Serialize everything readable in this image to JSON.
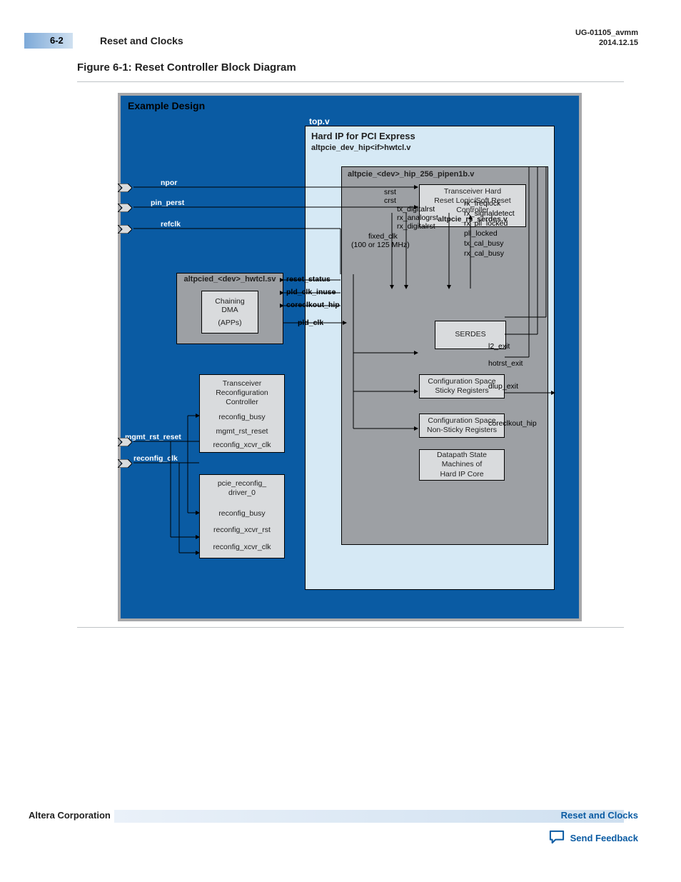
{
  "header": {
    "page_num": "6-2",
    "title": "Reset and Clocks",
    "doc_id": "UG-01105_avmm",
    "doc_date": "2014.12.15"
  },
  "figure": {
    "title": "Figure 6-1: Reset Controller Block Diagram",
    "example_design": "Example Design",
    "topv": "top.v",
    "hip_title": "Hard IP for PCI Express",
    "hip_sub": "altpcie_dev_hip<if>hwtcl.v",
    "pipen_title": "altpcie_<dev>_hip_256_pipen1b.v",
    "apps_title": "altpcied_<dev>_hwtcl.sv",
    "apps_line1": "Chaining",
    "apps_line2": "DMA",
    "apps_line3": "(APPs)",
    "xcvr_reset_box": {
      "line1": "Transceiver Hard",
      "line2": "Reset Logic/Soft Reset",
      "line3": "Controller",
      "line4": "altpcie_rs_serdes.v"
    },
    "serdes": "SERDES",
    "cfg_sticky": {
      "line1": "Configuration Space",
      "line2": "Sticky Registers"
    },
    "cfg_nonsticky": {
      "line1": "Configuration Space",
      "line2": "Non-Sticky Registers"
    },
    "datapath": {
      "line1": "Datapath State",
      "line2": "Machines of",
      "line3": "Hard IP Core"
    },
    "xcvr_reconfig": {
      "line1": "Transceiver",
      "line2": "Reconfiguration",
      "line3": "Controller",
      "label1": "reconfig_busy",
      "label2": "mgmt_rst_reset",
      "label3": "reconfig_xcvr_clk"
    },
    "pcie_reconfig": {
      "line1": "pcie_reconfig_",
      "line2": "driver_0",
      "label1": "reconfig_busy",
      "label2": "reconfig_xcvr_rst",
      "label3": "reconfig_xcvr_clk"
    },
    "pins": {
      "npor": "npor",
      "pin_perst": "pin_perst",
      "refclk": "refclk",
      "mgmt_rst_reset": "mgmt_rst_reset",
      "reconfig_clk": "reconfig_clk"
    },
    "sig_labels": {
      "reset_status": "reset_status",
      "pld_clk_inuse": "pld_clk_inuse",
      "coreclkout_hip": "coreclkout_hip",
      "pld_clk": "pld_clk",
      "srst": "srst",
      "crst": "crst",
      "tx_digitalrst": "tx_digitalrst",
      "rx_analogrst": "rx_analogrst",
      "rx_digitalrst": "rx_digitalrst",
      "fixed_clk": "fixed_clk",
      "fixed_clk_sub": "(100 or 125 MHz)",
      "rx_freqlock": "rx_freqlock",
      "rx_signaldetect": "rx_signaldetect",
      "rx_pll_locked": "rx_pll_locked",
      "pll_locked": "pll_locked",
      "tx_cal_busy": "tx_cal_busy",
      "rx_cal_busy": "rx_cal_busy",
      "l2_exit": "l2_exit",
      "hotrst_exit": "hotrst_exit",
      "dlup_exit": "dlup_exit",
      "coreclkout_hip_out": "coreclkout_hip"
    }
  },
  "footer": {
    "corp": "Altera Corporation",
    "link": "Reset and Clocks",
    "feedback": "Send Feedback"
  }
}
